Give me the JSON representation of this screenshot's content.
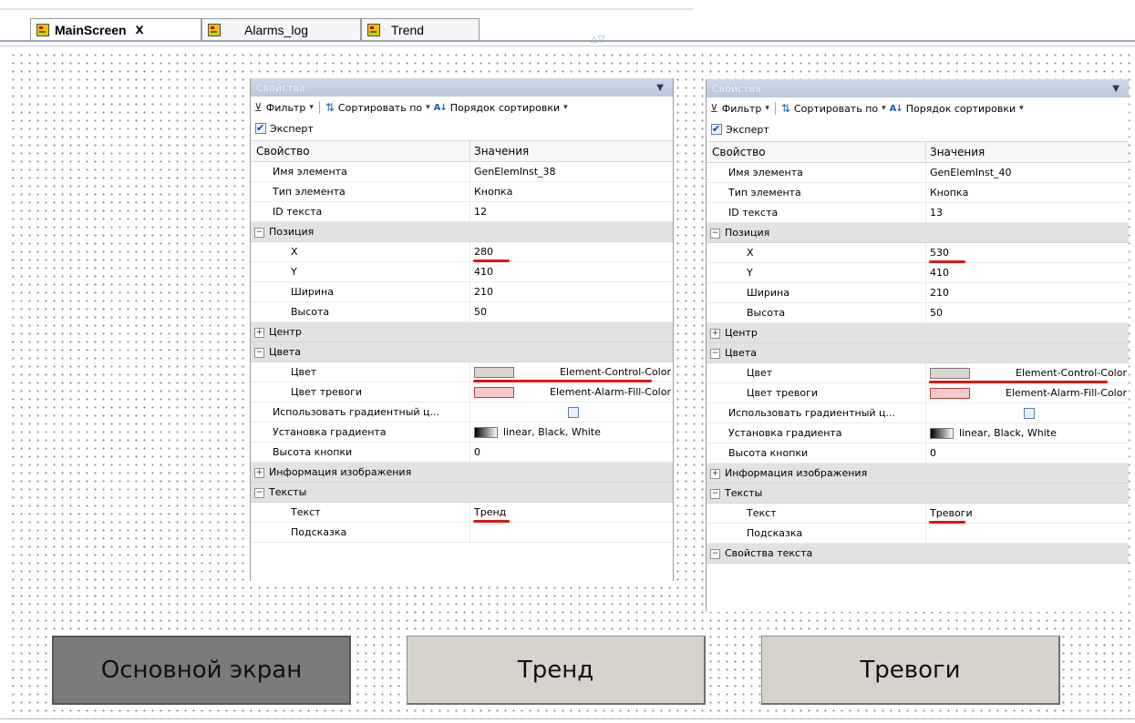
{
  "tabs": [
    {
      "label": "MainScreen",
      "active": true,
      "icon": "screen-icon",
      "closable": true
    },
    {
      "label": "Alarms_log",
      "active": false,
      "icon": "screen-icon"
    },
    {
      "label": "Trend",
      "active": false,
      "icon": "screen-icon"
    }
  ],
  "tab_close_glyph": "x",
  "panels": [
    {
      "title": "Свойства",
      "toolbar": {
        "filter": "Фильтр",
        "sort_by": "Сортировать по",
        "sort_order": "Порядок сортировки"
      },
      "expert": {
        "label": "Эксперт",
        "checked": true
      },
      "header": {
        "property": "Свойство",
        "value": "Значения"
      },
      "rows": [
        {
          "type": "prop",
          "label": "Имя элемента",
          "value": "GenElemInst_38",
          "level": 1
        },
        {
          "type": "prop",
          "label": "Тип элемента",
          "value": "Кнопка",
          "level": 1
        },
        {
          "type": "prop",
          "label": "ID текста",
          "value": "12",
          "level": 1
        },
        {
          "type": "group",
          "label": "Позиция",
          "toggle": "−"
        },
        {
          "type": "prop",
          "label": "X",
          "value": "280",
          "level": 2,
          "underline": true
        },
        {
          "type": "prop",
          "label": "Y",
          "value": "410",
          "level": 2
        },
        {
          "type": "prop",
          "label": "Ширина",
          "value": "210",
          "level": 2
        },
        {
          "type": "prop",
          "label": "Высота",
          "value": "50",
          "level": 2
        },
        {
          "type": "group",
          "label": "Центр",
          "toggle": "+"
        },
        {
          "type": "group",
          "label": "Цвета",
          "toggle": "−"
        },
        {
          "type": "color",
          "label": "Цвет",
          "value": "Element-Control-Color",
          "swatch": "grey",
          "level": 2,
          "underline": true
        },
        {
          "type": "color",
          "label": "Цвет тревоги",
          "value": "Element-Alarm-Fill-Color",
          "swatch": "pink",
          "level": 2
        },
        {
          "type": "check",
          "label": "Использовать градиентный ц...",
          "level": 1
        },
        {
          "type": "color",
          "label": "Установка градиента",
          "value": "linear, Black, White",
          "swatch": "grad",
          "level": 1,
          "left": true
        },
        {
          "type": "prop",
          "label": "Высота кнопки",
          "value": "0",
          "level": 1
        },
        {
          "type": "group",
          "label": "Информация изображения",
          "toggle": "+"
        },
        {
          "type": "group",
          "label": "Тексты",
          "toggle": "−"
        },
        {
          "type": "prop",
          "label": "Текст",
          "value": "Тренд",
          "level": 2,
          "underline": true
        },
        {
          "type": "prop",
          "label": "Подсказка",
          "value": "",
          "level": 2
        }
      ]
    },
    {
      "title": "Свойства",
      "toolbar": {
        "filter": "Фильтр",
        "sort_by": "Сортировать по",
        "sort_order": "Порядок сортировки"
      },
      "expert": {
        "label": "Эксперт",
        "checked": true
      },
      "header": {
        "property": "Свойство",
        "value": "Значения"
      },
      "rows": [
        {
          "type": "prop",
          "label": "Имя элемента",
          "value": "GenElemInst_40",
          "level": 1
        },
        {
          "type": "prop",
          "label": "Тип элемента",
          "value": "Кнопка",
          "level": 1
        },
        {
          "type": "prop",
          "label": "ID текста",
          "value": "13",
          "level": 1
        },
        {
          "type": "group",
          "label": "Позиция",
          "toggle": "−"
        },
        {
          "type": "prop",
          "label": "X",
          "value": "530",
          "level": 2,
          "underline": true
        },
        {
          "type": "prop",
          "label": "Y",
          "value": "410",
          "level": 2
        },
        {
          "type": "prop",
          "label": "Ширина",
          "value": "210",
          "level": 2
        },
        {
          "type": "prop",
          "label": "Высота",
          "value": "50",
          "level": 2
        },
        {
          "type": "group",
          "label": "Центр",
          "toggle": "+"
        },
        {
          "type": "group",
          "label": "Цвета",
          "toggle": "−"
        },
        {
          "type": "color",
          "label": "Цвет",
          "value": "Element-Control-Color",
          "swatch": "grey",
          "level": 2,
          "underline": true
        },
        {
          "type": "color",
          "label": "Цвет тревоги",
          "value": "Element-Alarm-Fill-Color",
          "swatch": "pink",
          "level": 2
        },
        {
          "type": "check",
          "label": "Использовать градиентный ц...",
          "level": 1
        },
        {
          "type": "color",
          "label": "Установка градиента",
          "value": "linear, Black, White",
          "swatch": "grad",
          "level": 1,
          "left": true
        },
        {
          "type": "prop",
          "label": "Высота кнопки",
          "value": "0",
          "level": 1
        },
        {
          "type": "group",
          "label": "Информация изображения",
          "toggle": "+"
        },
        {
          "type": "group",
          "label": "Тексты",
          "toggle": "−"
        },
        {
          "type": "prop",
          "label": "Текст",
          "value": "Тревоги",
          "level": 2,
          "underline": true
        },
        {
          "type": "prop",
          "label": "Подсказка",
          "value": "",
          "level": 2
        },
        {
          "type": "group",
          "label": "Свойства текста",
          "toggle": "−"
        }
      ]
    }
  ],
  "screen_buttons": [
    {
      "label": "Основной экран",
      "style": "dark"
    },
    {
      "label": "Тренд",
      "style": "light"
    },
    {
      "label": "Тревоги",
      "style": "light"
    }
  ],
  "colors": {
    "underline": "#e01414",
    "panel_title": "#c4d0e2",
    "button_face": "#d6d3cd",
    "button_active": "#7b7b7b"
  }
}
